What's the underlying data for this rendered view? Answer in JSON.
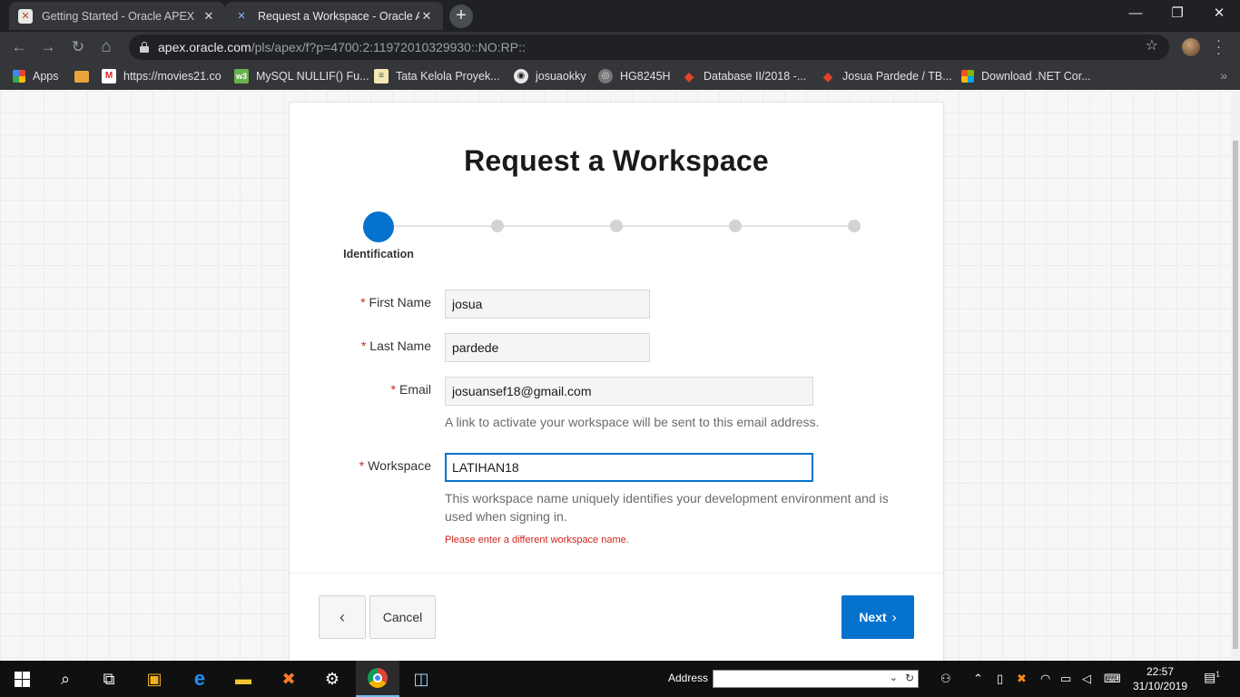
{
  "browser": {
    "tabs": [
      {
        "title": "Getting Started - Oracle APEX",
        "active": false,
        "favicon": "apex-icon"
      },
      {
        "title": "Request a Workspace - Oracle Ap",
        "active": true,
        "favicon": "apex-icon"
      }
    ],
    "new_tab": "+",
    "window_controls": {
      "minimize": "—",
      "maximize": "❐",
      "close": "✕"
    },
    "nav": {
      "back": "←",
      "forward": "→",
      "reload": "↻",
      "home": "⌂"
    },
    "url": {
      "host": "apex.oracle.com",
      "path": "/pls/apex/f?p=4700:2:11972010329930::NO:RP::"
    },
    "bookmark_star": "☆",
    "bookmarks": [
      {
        "label": "Apps",
        "icon": "apps-grid-icon"
      },
      {
        "label": "",
        "icon": "bookmark-folder-icon"
      },
      {
        "label": "https://movies21.co",
        "icon": "movies-icon"
      },
      {
        "label": "MySQL NULLIF() Fu...",
        "icon": "w3-icon"
      },
      {
        "label": "Tata Kelola Proyek...",
        "icon": "document-icon"
      },
      {
        "label": "josuaokky",
        "icon": "github-icon"
      },
      {
        "label": "HG8245H",
        "icon": "globe-icon"
      },
      {
        "label": "Database II/2018 -...",
        "icon": "gitlab-icon"
      },
      {
        "label": "Josua Pardede / TB...",
        "icon": "gitlab-icon"
      },
      {
        "label": "Download .NET Cor...",
        "icon": "microsoft-icon"
      }
    ],
    "bookmarks_more": "»"
  },
  "form": {
    "title": "Request a Workspace",
    "wizard": {
      "steps_total": 5,
      "current_step": 1,
      "current_label": "Identification"
    },
    "fields": {
      "first_name": {
        "label": "First Name",
        "value": "josua",
        "required": true
      },
      "last_name": {
        "label": "Last Name",
        "value": "pardede",
        "required": true
      },
      "email": {
        "label": "Email",
        "value": "josuansef18@gmail.com",
        "required": true,
        "help": "A link to activate your workspace will be sent to this email address."
      },
      "workspace": {
        "label": "Workspace",
        "value": "LATIHAN18",
        "required": true,
        "help": "This workspace name uniquely identifies your development environment and is used when signing in.",
        "error": "Please enter a different workspace name."
      }
    },
    "required_marker": "*",
    "buttons": {
      "back": "‹",
      "cancel": "Cancel",
      "next": "Next",
      "next_chevron": "›"
    }
  },
  "taskbar": {
    "address_label": "Address",
    "address_value": "",
    "clock_time": "22:57",
    "clock_date": "31/10/2019",
    "notification_count": "1",
    "colors": {
      "accent": "#0572ce",
      "error": "#d0261d"
    }
  }
}
